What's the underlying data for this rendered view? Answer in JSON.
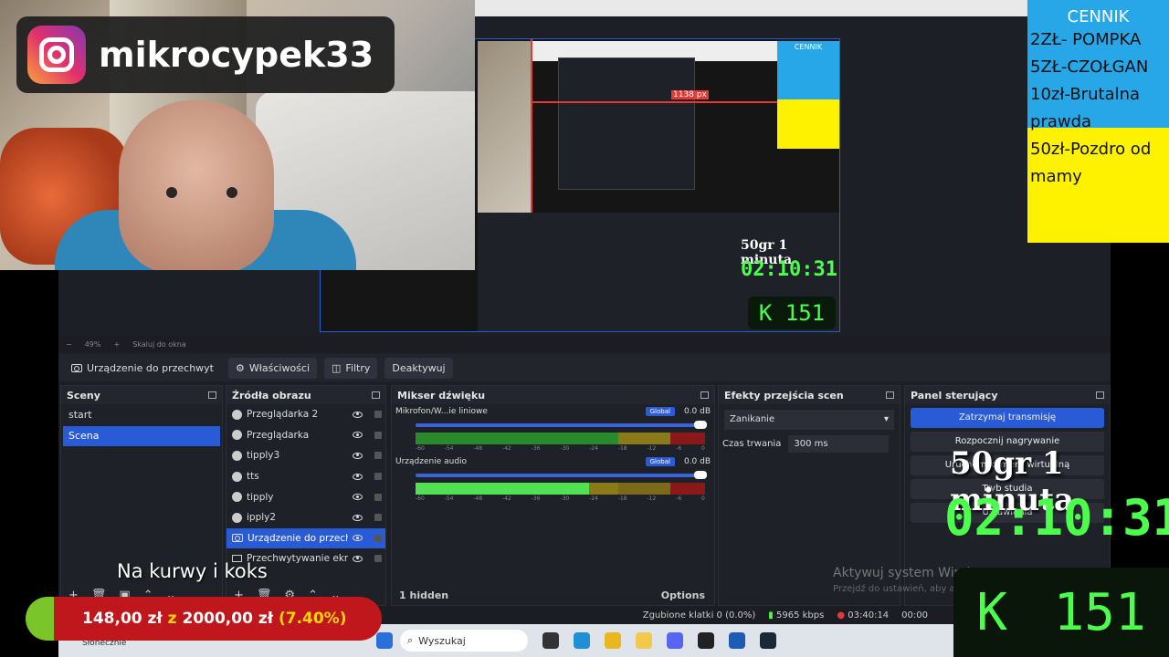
{
  "overlays": {
    "instagram_handle": "mikrocypek33",
    "price_list": {
      "title": "CENNIK",
      "lines": [
        "2ZŁ- POMPKA",
        "5ZŁ-CZOŁGAN",
        "10zł-Brutalna",
        "prawda",
        "50zł-Pozdro od",
        "mamy"
      ]
    },
    "timer_label": "50gr 1 minuta",
    "timer_clock": "02:10:31",
    "counter_letter": "K",
    "counter_value": "151",
    "caption": "Na kurwy i koks",
    "goal": {
      "current": "148,00 zł",
      "z": "z",
      "target": "2000,00 zł",
      "percent": "(7.40%)"
    }
  },
  "preview": {
    "zoom": "49%",
    "scale_label": "Skaluj do okna",
    "px_label": "1138 px",
    "mini_timer_label": "50gr 1 minuta",
    "mini_clock": "02:10:31",
    "mini_counter": "K 151"
  },
  "source_toolbar": {
    "device": "Urządzenie do przechwyt",
    "properties": "Właściwości",
    "filters": "Filtry",
    "deactivate": "Deaktywuj"
  },
  "scenes": {
    "title": "Sceny",
    "items": [
      {
        "label": "start",
        "active": false
      },
      {
        "label": "Scena",
        "active": true
      }
    ]
  },
  "sources": {
    "title": "Źródła obrazu",
    "items": [
      {
        "label": "Przeglądarka 2",
        "icon": "globe"
      },
      {
        "label": "Przeglądarka",
        "icon": "globe"
      },
      {
        "label": "tipply3",
        "icon": "globe"
      },
      {
        "label": "tts",
        "icon": "globe"
      },
      {
        "label": "tipply",
        "icon": "globe"
      },
      {
        "label": "ipply2",
        "icon": "globe"
      },
      {
        "label": "Urządzenie do przechw",
        "icon": "camera",
        "active": true
      },
      {
        "label": "Przechwytywanie ekra",
        "icon": "monitor"
      }
    ]
  },
  "mixer": {
    "title": "Mikser dźwięku",
    "channels": [
      {
        "name": "Mikrofon/W...ie liniowe",
        "db": "0.0 dB",
        "badge": "Global"
      },
      {
        "name": "Urządzenie audio",
        "db": "0.0 dB",
        "badge": "Global"
      }
    ],
    "ticks": [
      "-60",
      "-54",
      "-48",
      "-42",
      "-36",
      "-30",
      "-24",
      "-18",
      "-12",
      "-6",
      "0"
    ],
    "hidden": "1 hidden",
    "options": "Options"
  },
  "transitions": {
    "title": "Efekty przejścia scen",
    "selected": "Zanikanie",
    "duration_label": "Czas trwania",
    "duration_value": "300 ms"
  },
  "controls": {
    "title": "Panel sterujący",
    "buttons": [
      "Zatrzymaj transmisję",
      "Rozpocznij nagrywanie",
      "Uruchom kamerę wirtualną",
      "Tryb studia",
      "Ustawienia"
    ]
  },
  "status": {
    "dropped": "Zgubione klatki 0 (0.0%)",
    "bitrate": "5965 kbps",
    "time": "03:40:14",
    "time2": "00:00"
  },
  "watermark": {
    "line1": "Aktywuj system Windows",
    "line2": "Przejdź do ustawień, aby aktywować system Windows."
  },
  "taskbar": {
    "search": "Wyszukaj",
    "weather": "Słonecznie"
  }
}
